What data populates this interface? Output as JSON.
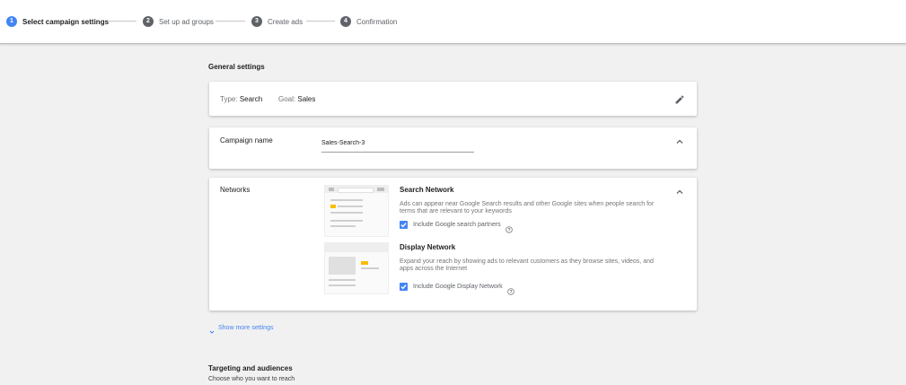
{
  "stepper": {
    "steps": [
      {
        "num": "1",
        "label": "Select campaign settings",
        "active": true
      },
      {
        "num": "2",
        "label": "Set up ad groups",
        "active": false
      },
      {
        "num": "3",
        "label": "Create ads",
        "active": false
      },
      {
        "num": "4",
        "label": "Confirmation",
        "active": false
      }
    ]
  },
  "general_settings": {
    "title": "General settings",
    "type_label": "Type:",
    "type_value": "Search",
    "goal_label": "Goal:",
    "goal_value": "Sales"
  },
  "campaign_name": {
    "label": "Campaign name",
    "value": "Sales-Search-3"
  },
  "networks": {
    "label": "Networks",
    "search": {
      "title": "Search Network",
      "description": "Ads can appear near Google Search results and other Google sites when people search for terms that are relevant to your keywords",
      "checkbox_label": "Include Google search partners",
      "checked": true
    },
    "display": {
      "title": "Display Network",
      "description": "Expand your reach by showing ads to relevant customers as they browse sites, videos, and apps across the Internet",
      "checkbox_label": "Include Google Display Network",
      "checked": true
    }
  },
  "show_more": "Show more settings",
  "targeting": {
    "title": "Targeting and audiences",
    "subtitle": "Choose who you want to reach"
  },
  "colors": {
    "accent": "#4285f4",
    "ad_highlight": "#fbbc04"
  }
}
